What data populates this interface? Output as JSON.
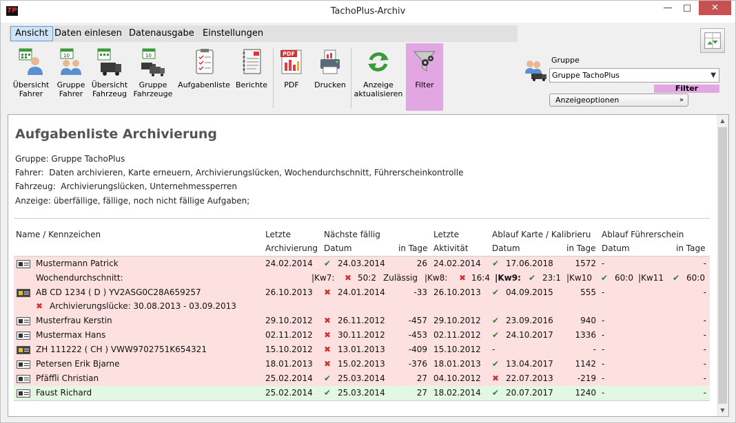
{
  "window": {
    "title": "TachoPlus-Archiv",
    "minimize": "—",
    "maximize": "□",
    "close": "✕",
    "logo": "TP"
  },
  "menu": [
    "Ansicht",
    "Daten einlesen",
    "Datenausgabe",
    "Einstellungen"
  ],
  "toolbar": {
    "uebersicht_fahrer": "Übersicht\nFahrer",
    "gruppe_fahrer": "Gruppe\nFahrer",
    "uebersicht_fahrzeug": "Übersicht\nFahrzeug",
    "gruppe_fahrzeuge": "Gruppe\nFahrzeuge",
    "aufgabenliste": "Aufgabenliste",
    "berichte": "Berichte",
    "pdf": "PDF",
    "drucken": "Drucken",
    "anzeige_aktualisieren": "Anzeige\naktualisieren",
    "filter": "Filter"
  },
  "group_panel": {
    "label": "Gruppe",
    "selected": "Gruppe TachoPlus",
    "filter_badge": "Filter",
    "anzeigeoptionen": "Anzeigeoptionen"
  },
  "report": {
    "title": "Aufgabenliste Archivierung",
    "gruppe_line": "Gruppe: Gruppe TachoPlus",
    "fahrer_line": "Fahrer:  Daten archivieren, Karte erneuern, Archivierungslücken, Wochendurchschnitt, Führerscheinkontrolle",
    "fahrzeug_line": "Fahrzeug:  Archivierungslücken, Unternehmessperren",
    "anzeige_line": "Anzeige: überfällige, fällige, noch nicht fällige Aufgaben;"
  },
  "table": {
    "headers": {
      "name": "Name / Kennzeichen",
      "letzte_arch_1": "Letzte",
      "letzte_arch_2": "Archivierung",
      "naechste_1": "Nächste fällig",
      "naechste_datum": "Datum",
      "naechste_tage": "in Tage",
      "letzte_akt_1": "Letzte",
      "letzte_akt_2": "Aktivität",
      "ablauf_karte_1": "Ablauf Karte / Kalibrieru",
      "ablauf_karte_datum": "Datum",
      "ablauf_karte_tage": "in Tage",
      "ablauf_fs_1": "Ablauf Führerschein",
      "ablauf_fs_datum": "Datum",
      "ablauf_fs_tage": "in Tage"
    },
    "rows": [
      {
        "name": "Mustermann Patrick",
        "arch": "24.02.2014",
        "due_ok": true,
        "due": "24.03.2014",
        "days": "26",
        "act": "24.02.2014",
        "card_ok": true,
        "card": "17.06.2018",
        "card_days": "1572",
        "fs": "-",
        "fs_days": "-"
      },
      {
        "name": "AB CD 1234 ( D ) YV2ASG0C28A659257",
        "arch": "26.10.2013",
        "due_ok": false,
        "due": "24.01.2014",
        "days": "-33",
        "act": "26.10.2013",
        "card_ok": true,
        "card": "04.09.2015",
        "card_days": "555",
        "fs": "-",
        "fs_days": "-"
      },
      {
        "name": "Musterfrau Kerstin",
        "arch": "29.10.2012",
        "due_ok": false,
        "due": "26.11.2012",
        "days": "-457",
        "act": "29.10.2012",
        "card_ok": true,
        "card": "23.09.2016",
        "card_days": "940",
        "fs": "-",
        "fs_days": "-"
      },
      {
        "name": "Mustermax Hans",
        "arch": "02.11.2012",
        "due_ok": false,
        "due": "30.11.2012",
        "days": "-453",
        "act": "02.11.2012",
        "card_ok": true,
        "card": "24.10.2017",
        "card_days": "1336",
        "fs": "-",
        "fs_days": "-"
      },
      {
        "name": "ZH 111222 ( CH ) VWW9702751K654321",
        "arch": "15.10.2012",
        "due_ok": false,
        "due": "13.01.2013",
        "days": "-409",
        "act": "15.10.2012",
        "card": "-",
        "card_days": "-",
        "fs": "-",
        "fs_days": "-"
      },
      {
        "name": "Petersen Erik Bjarne",
        "arch": "18.01.2013",
        "due_ok": false,
        "due": "15.02.2013",
        "days": "-376",
        "act": "18.01.2013",
        "card_ok": true,
        "card": "13.04.2017",
        "card_days": "1142",
        "fs": "-",
        "fs_days": "-"
      },
      {
        "name": "Pfäffli Christian",
        "arch": "25.02.2014",
        "due_ok": true,
        "due": "25.03.2014",
        "days": "27",
        "act": "04.10.2012",
        "card_ok": false,
        "card": "22.07.2013",
        "card_days": "-219",
        "fs": "-",
        "fs_days": "-"
      },
      {
        "name": "Faust Richard",
        "arch": "25.02.2014",
        "due_ok": true,
        "due": "25.03.2014",
        "days": "27",
        "act": "18.02.2014",
        "card_ok": true,
        "card": "20.07.2017",
        "card_days": "1240",
        "fs": "-",
        "fs_days": "-"
      }
    ],
    "week_avg": {
      "label": "Wochendurchschnitt:",
      "kw7": "|Kw7:",
      "kw7_val": "50:2",
      "kw7_note": "Zulässig",
      "kw8": "|Kw8:",
      "kw8_val": "16:4",
      "kw9": "|Kw9:",
      "kw9_val": "23:1",
      "kw10": "|Kw10",
      "kw10_val": "60:0",
      "kw11": "|Kw11",
      "kw11_val": "60:0"
    },
    "gap_note": "Archivierungslücke: 30.08.2013 - 03.09.2013"
  },
  "symbols": {
    "check": "✔",
    "cross": "✖"
  },
  "colors": {
    "overdue_row": "#fde0e0",
    "ok_row": "#e3f8e3",
    "filter_active": "#e2a6e2",
    "check": "#2e7d32",
    "cross": "#d32f2f"
  }
}
